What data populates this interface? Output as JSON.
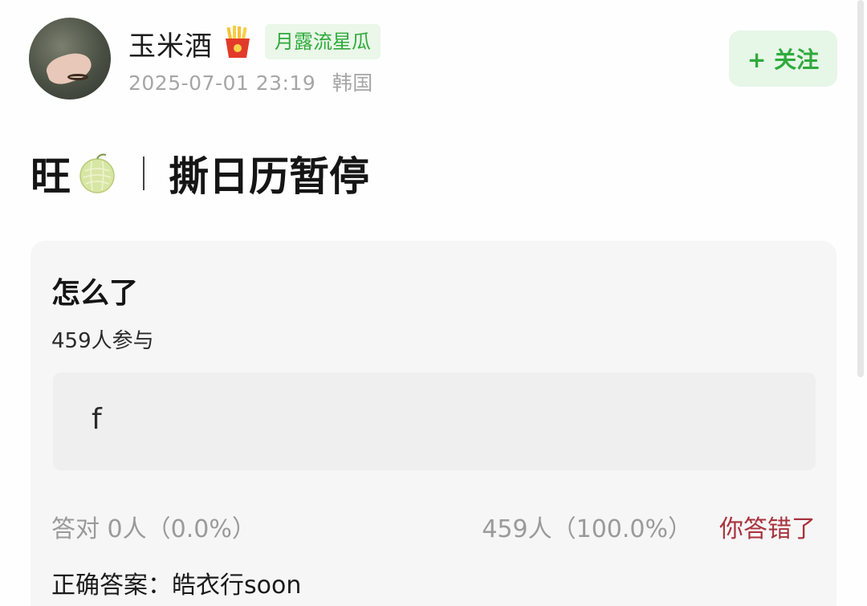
{
  "user": {
    "name": "玉米酒",
    "badge": "月露流星瓜",
    "date": "2025-07-01 23:19",
    "location": "韩国",
    "follow_label": "+ 关注"
  },
  "post": {
    "title_prefix": "旺",
    "title_main": "撕日历暂停"
  },
  "quiz": {
    "question": "怎么了",
    "participants": "459人参与",
    "option": "f",
    "correct_stat": "答对  0人（0.0%）",
    "user_stat": "459人（100.0%）",
    "result": "你答错了",
    "answer": "正确答案：皓衣行soon"
  },
  "colors": {
    "accent_green": "#2faa3b",
    "badge_bg": "#eaf7e9",
    "wrong_red": "#a8333d"
  },
  "icons": {
    "badge_icon": "french-fries-icon",
    "title_icon": "melon-icon"
  }
}
